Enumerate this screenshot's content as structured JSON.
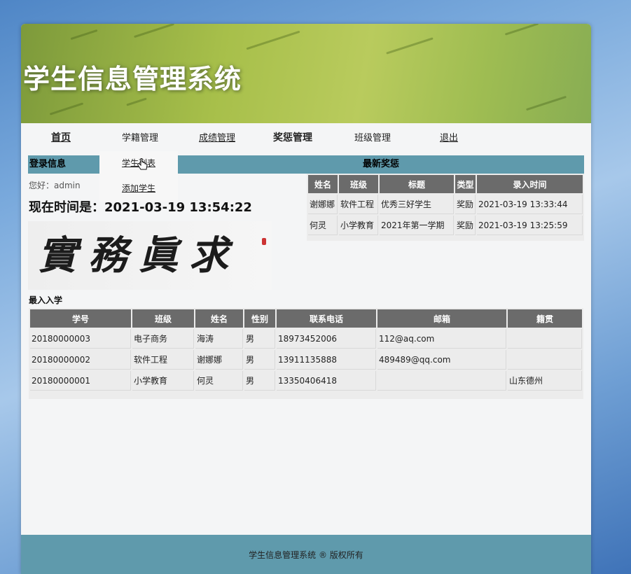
{
  "app": {
    "title": "学生信息管理系统"
  },
  "nav": {
    "home": "首页",
    "status": "学籍管理",
    "scores": "成绩管理",
    "rewards": "奖惩管理",
    "classes": "班级管理",
    "logout": "退出"
  },
  "dropdown": {
    "list": "学生列表",
    "add": "添加学生"
  },
  "login": {
    "header": "登录信息",
    "greeting": "您好：admin",
    "clock": "现在时间是：2021-03-19 13:54:22"
  },
  "calligraphy": "實務眞求",
  "rewards": {
    "header": "最新奖惩",
    "columns": [
      "姓名",
      "班级",
      "标题",
      "类型",
      "录入时间"
    ],
    "rows": [
      [
        "谢娜娜",
        "软件工程",
        "优秀三好学生",
        "奖励",
        "2021-03-19 13:33:44"
      ],
      [
        "何灵",
        "小学教育",
        "2021年第一学期",
        "奖励",
        "2021-03-19 13:25:59"
      ]
    ]
  },
  "admissions": {
    "header": "最入入学",
    "columns": [
      "学号",
      "班级",
      "姓名",
      "性别",
      "联系电话",
      "邮箱",
      "籍贯"
    ],
    "rows": [
      [
        "20180000003",
        "电子商务",
        "海涛",
        "男",
        "18973452006",
        "112@aq.com",
        ""
      ],
      [
        "20180000002",
        "软件工程",
        "谢娜娜",
        "男",
        "13911135888",
        "489489@qq.com",
        ""
      ],
      [
        "20180000001",
        "小学教育",
        "何灵",
        "男",
        "13350406418",
        "",
        "山东德州"
      ]
    ]
  },
  "footer": "学生信息管理系统 ® 版权所有"
}
